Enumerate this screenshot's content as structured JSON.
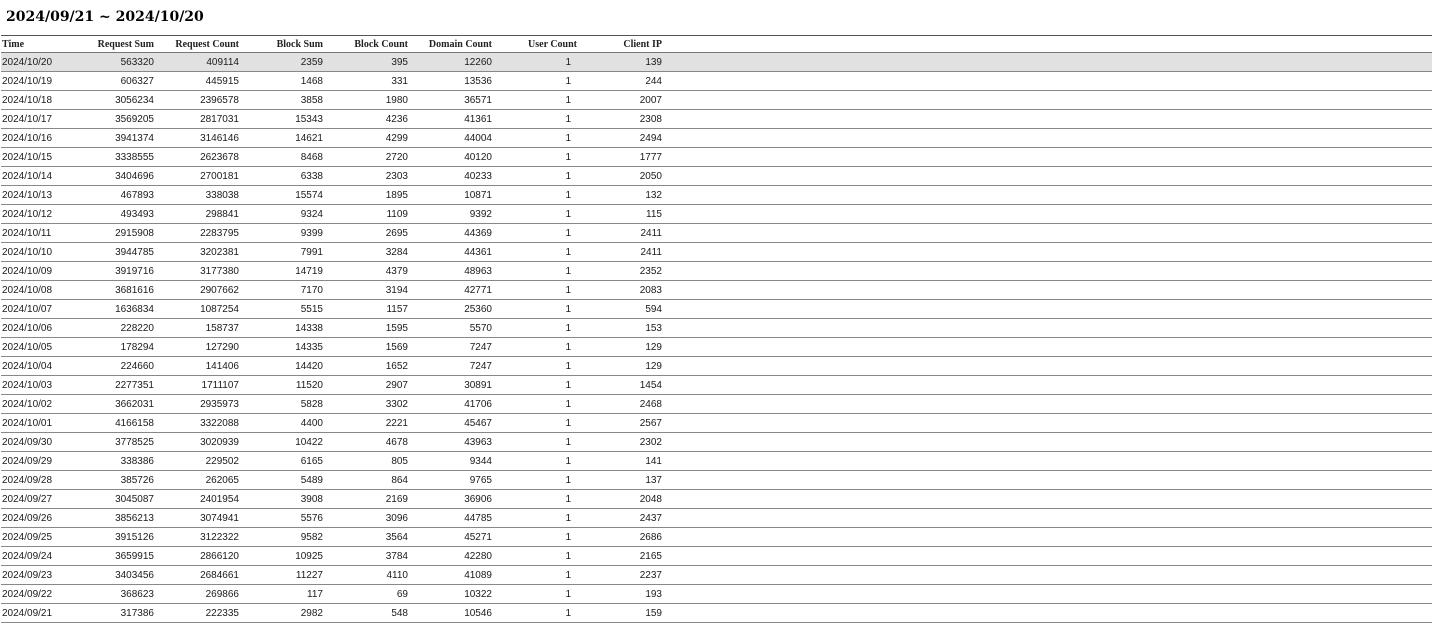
{
  "report": {
    "date_range": "2024/09/21 ~ 2024/10/20",
    "selected_row_index": 0,
    "columns": [
      "Time",
      "Request Sum",
      "Request Count",
      "Block Sum",
      "Block Count",
      "Domain Count",
      "User Count",
      "Client IP"
    ],
    "rows": [
      [
        "2024/10/20",
        "563320",
        "409114",
        "2359",
        "395",
        "12260",
        "1",
        "139"
      ],
      [
        "2024/10/19",
        "606327",
        "445915",
        "1468",
        "331",
        "13536",
        "1",
        "244"
      ],
      [
        "2024/10/18",
        "3056234",
        "2396578",
        "3858",
        "1980",
        "36571",
        "1",
        "2007"
      ],
      [
        "2024/10/17",
        "3569205",
        "2817031",
        "15343",
        "4236",
        "41361",
        "1",
        "2308"
      ],
      [
        "2024/10/16",
        "3941374",
        "3146146",
        "14621",
        "4299",
        "44004",
        "1",
        "2494"
      ],
      [
        "2024/10/15",
        "3338555",
        "2623678",
        "8468",
        "2720",
        "40120",
        "1",
        "1777"
      ],
      [
        "2024/10/14",
        "3404696",
        "2700181",
        "6338",
        "2303",
        "40233",
        "1",
        "2050"
      ],
      [
        "2024/10/13",
        "467893",
        "338038",
        "15574",
        "1895",
        "10871",
        "1",
        "132"
      ],
      [
        "2024/10/12",
        "493493",
        "298841",
        "9324",
        "1109",
        "9392",
        "1",
        "115"
      ],
      [
        "2024/10/11",
        "2915908",
        "2283795",
        "9399",
        "2695",
        "44369",
        "1",
        "2411"
      ],
      [
        "2024/10/10",
        "3944785",
        "3202381",
        "7991",
        "3284",
        "44361",
        "1",
        "2411"
      ],
      [
        "2024/10/09",
        "3919716",
        "3177380",
        "14719",
        "4379",
        "48963",
        "1",
        "2352"
      ],
      [
        "2024/10/08",
        "3681616",
        "2907662",
        "7170",
        "3194",
        "42771",
        "1",
        "2083"
      ],
      [
        "2024/10/07",
        "1636834",
        "1087254",
        "5515",
        "1157",
        "25360",
        "1",
        "594"
      ],
      [
        "2024/10/06",
        "228220",
        "158737",
        "14338",
        "1595",
        "5570",
        "1",
        "153"
      ],
      [
        "2024/10/05",
        "178294",
        "127290",
        "14335",
        "1569",
        "7247",
        "1",
        "129"
      ],
      [
        "2024/10/04",
        "224660",
        "141406",
        "14420",
        "1652",
        "7247",
        "1",
        "129"
      ],
      [
        "2024/10/03",
        "2277351",
        "1711107",
        "11520",
        "2907",
        "30891",
        "1",
        "1454"
      ],
      [
        "2024/10/02",
        "3662031",
        "2935973",
        "5828",
        "3302",
        "41706",
        "1",
        "2468"
      ],
      [
        "2024/10/01",
        "4166158",
        "3322088",
        "4400",
        "2221",
        "45467",
        "1",
        "2567"
      ],
      [
        "2024/09/30",
        "3778525",
        "3020939",
        "10422",
        "4678",
        "43963",
        "1",
        "2302"
      ],
      [
        "2024/09/29",
        "338386",
        "229502",
        "6165",
        "805",
        "9344",
        "1",
        "141"
      ],
      [
        "2024/09/28",
        "385726",
        "262065",
        "5489",
        "864",
        "9765",
        "1",
        "137"
      ],
      [
        "2024/09/27",
        "3045087",
        "2401954",
        "3908",
        "2169",
        "36906",
        "1",
        "2048"
      ],
      [
        "2024/09/26",
        "3856213",
        "3074941",
        "5576",
        "3096",
        "44785",
        "1",
        "2437"
      ],
      [
        "2024/09/25",
        "3915126",
        "3122322",
        "9582",
        "3564",
        "45271",
        "1",
        "2686"
      ],
      [
        "2024/09/24",
        "3659915",
        "2866120",
        "10925",
        "3784",
        "42280",
        "1",
        "2165"
      ],
      [
        "2024/09/23",
        "3403456",
        "2684661",
        "11227",
        "4110",
        "41089",
        "1",
        "2237"
      ],
      [
        "2024/09/22",
        "368623",
        "269866",
        "117",
        "69",
        "10322",
        "1",
        "193"
      ],
      [
        "2024/09/21",
        "317386",
        "222335",
        "2982",
        "548",
        "10546",
        "1",
        "159"
      ]
    ]
  },
  "colors": {
    "selected_row_bg": "#e1e1e1",
    "row_divider": "#888888",
    "header_border": "#555555"
  }
}
